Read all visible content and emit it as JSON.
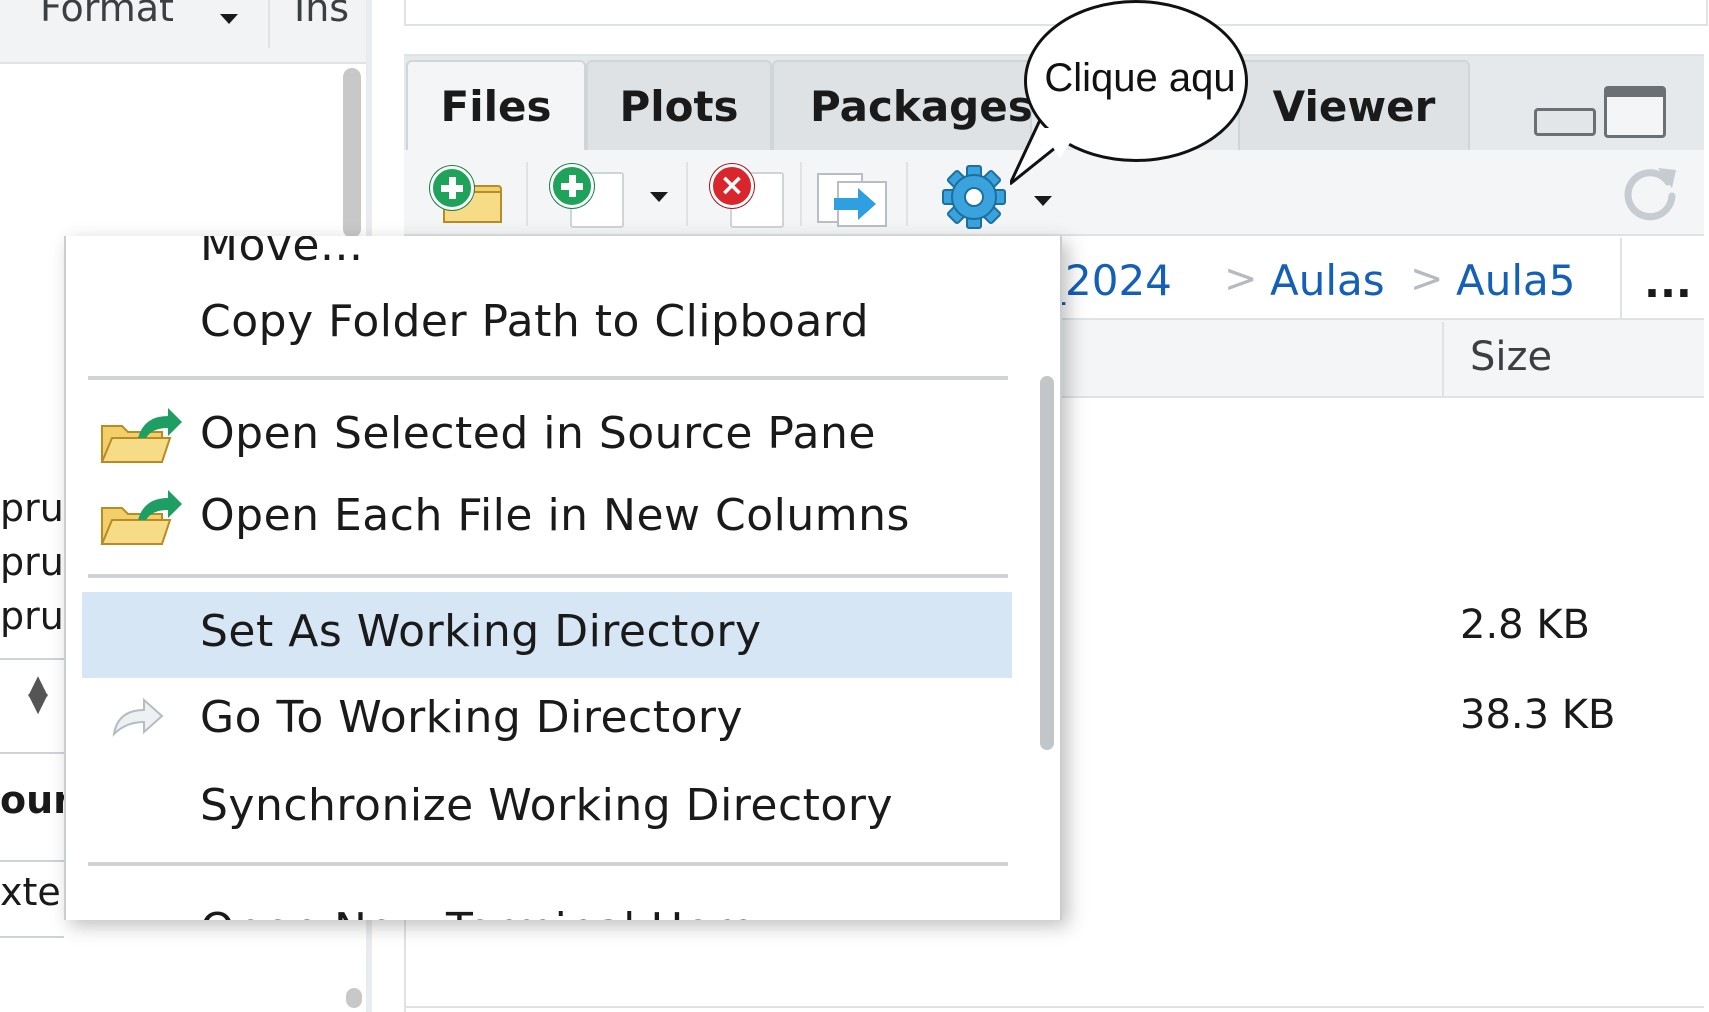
{
  "left_toolbar": {
    "format_label": "Format",
    "insert_label": "Ins"
  },
  "left_fragments": {
    "line1": "pruc",
    "line2": "pruc",
    "line3": "pruc",
    "heading": "our",
    "line4": "xter"
  },
  "tabs": [
    {
      "label": "Files"
    },
    {
      "label": "Plots"
    },
    {
      "label": "Packages"
    },
    {
      "label": "Viewer"
    }
  ],
  "bubble": {
    "text": "Clique aqu"
  },
  "breadcrumb": {
    "items": [
      "_2024",
      "Aulas",
      "Aula5"
    ],
    "separator": ">",
    "more": "..."
  },
  "table": {
    "size_header": "Size",
    "sizes": [
      "2.8 KB",
      "38.3 KB"
    ]
  },
  "menu": {
    "items": [
      {
        "label": "Move...",
        "icon": null
      },
      {
        "label": "Copy Folder Path to Clipboard",
        "icon": null
      },
      {
        "label": "Open Selected in Source Pane",
        "icon": "open-folder-arrow-icon"
      },
      {
        "label": "Open Each File in New Columns",
        "icon": "open-folder-arrow-icon"
      },
      {
        "label": "Set As Working Directory",
        "icon": null,
        "selected": true
      },
      {
        "label": "Go To Working Directory",
        "icon": "forward-arrow-icon"
      },
      {
        "label": "Synchronize Working Directory",
        "icon": null
      },
      {
        "label": "Open New Terminal Here",
        "icon": null
      }
    ]
  },
  "colors": {
    "accent_link": "#1560b7",
    "menu_selected": "#d6e6f4",
    "add_green": "#1fa35a",
    "delete_red": "#d9262c",
    "gear_blue": "#3aa3dd"
  }
}
